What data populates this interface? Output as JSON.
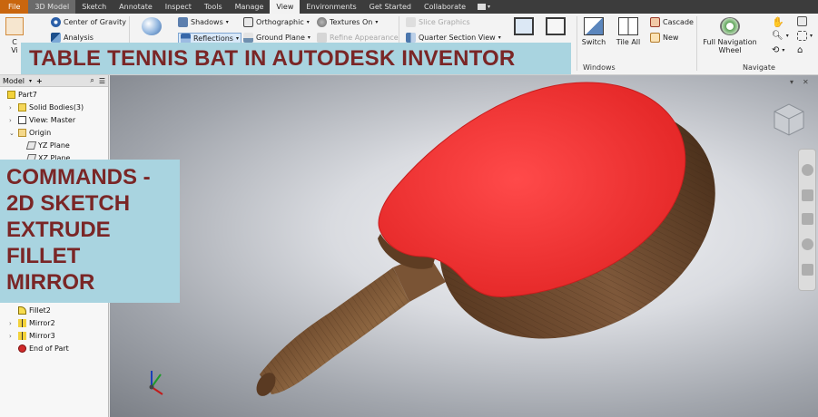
{
  "menu": {
    "tabs": [
      "File",
      "3D Model",
      "Sketch",
      "Annotate",
      "Inspect",
      "Tools",
      "Manage",
      "View",
      "Environments",
      "Get Started",
      "Collaborate"
    ],
    "active": "View"
  },
  "ribbon": {
    "center_of_gravity": "Center of Gravity",
    "analysis": "Analysis",
    "shadows": "Shadows",
    "reflections": "Reflections",
    "orthographic": "Orthographic",
    "ground_plane": "Ground Plane",
    "textures_on": "Textures On",
    "refine_appearance": "Refine Appearance",
    "slice_graphics": "Slice Graphics",
    "quarter_section_view": "Quarter Section View",
    "switch": "Switch",
    "tile_all": "Tile All",
    "cascade": "Cascade",
    "new": "New",
    "full_navigation_wheel_1": "Full Navigation",
    "full_navigation_wheel_2": "Wheel",
    "windows_group": "Windows",
    "navigate_group": "Navigate",
    "left_cut_1": "C",
    "left_cut_2": "Vi"
  },
  "title_overlay": "TABLE TENNIS BAT IN AUTODESK INVENTOR",
  "commands_overlay": {
    "lines": [
      "COMMANDS -",
      "2D SKETCH",
      "EXTRUDE",
      "FILLET",
      "MIRROR"
    ]
  },
  "browser": {
    "tab_label": "Model",
    "add_label": "+",
    "tree": {
      "part": "Part7",
      "solid_bodies": "Solid Bodies(3)",
      "view_master": "View: Master",
      "origin": "Origin",
      "yz_plane": "YZ Plane",
      "xz_plane": "XZ Plane",
      "fillet2": "Fillet2",
      "mirror2": "Mirror2",
      "mirror3": "Mirror3",
      "end_of_part": "End of Part"
    }
  },
  "colors": {
    "rubber_red": "#f03535",
    "wood_brown": "#6e4a2d",
    "overlay_blue": "#a9d4e0",
    "overlay_text": "#7a2626",
    "file_tab_orange": "#c9660e"
  }
}
